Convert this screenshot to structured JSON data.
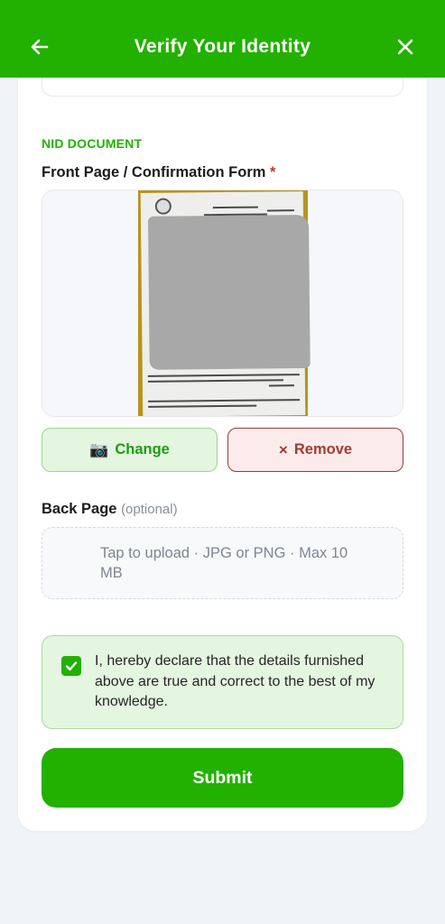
{
  "header": {
    "title": "Verify Your Identity",
    "back_icon": "arrow-left-icon",
    "close_icon": "close-icon"
  },
  "section": {
    "label": "NID DOCUMENT"
  },
  "front_page": {
    "label": "Front Page / Confirmation Form",
    "required_mark": "*",
    "change_icon": "📷",
    "change_label": "Change",
    "remove_icon": "×",
    "remove_label": "Remove"
  },
  "back_page": {
    "label": "Back Page",
    "optional_text": "(optional)",
    "upload_hint": "Tap to upload · JPG or PNG · Max 10 MB"
  },
  "declaration": {
    "checked": true,
    "text": "I, hereby declare that the details furnished above are true and correct to the best of my knowledge."
  },
  "submit": {
    "label": "Submit"
  },
  "colors": {
    "primary": "#22b100",
    "remove": "#a33a30",
    "required": "#c0392b"
  }
}
